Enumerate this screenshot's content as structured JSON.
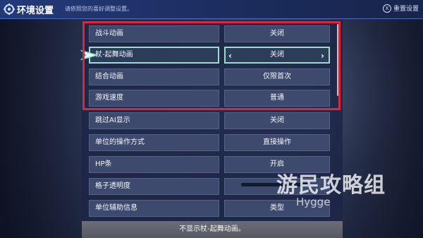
{
  "header": {
    "title": "环境设置",
    "subtitle": "请依照您的喜好调整设置。",
    "reset_label": "重置设置"
  },
  "settings": [
    {
      "label": "战斗动画",
      "value": "关闭",
      "selected": false
    },
    {
      "label": "杖-起舞动画",
      "value": "关闭",
      "selected": true
    },
    {
      "label": "结合动画",
      "value": "仅限首次",
      "selected": false
    },
    {
      "label": "游戏速度",
      "value": "普通",
      "selected": false
    },
    {
      "label": "跳过AI显示",
      "value": "关闭",
      "selected": false
    },
    {
      "label": "单位的操作方式",
      "value": "直接操作",
      "selected": false
    },
    {
      "label": "HP条",
      "value": "开启",
      "selected": false
    },
    {
      "label": "格子透明度",
      "value": "",
      "selected": false
    },
    {
      "label": "单位辅助信息",
      "value": "类型",
      "selected": false
    }
  ],
  "help_text": "不显示杖-起舞动画。",
  "watermark": {
    "cn": "游民攻略组",
    "en": "Hygge"
  },
  "colors": {
    "highlight": "#e0243a",
    "selection": "#9fd9cf",
    "header": "#233a7a"
  }
}
